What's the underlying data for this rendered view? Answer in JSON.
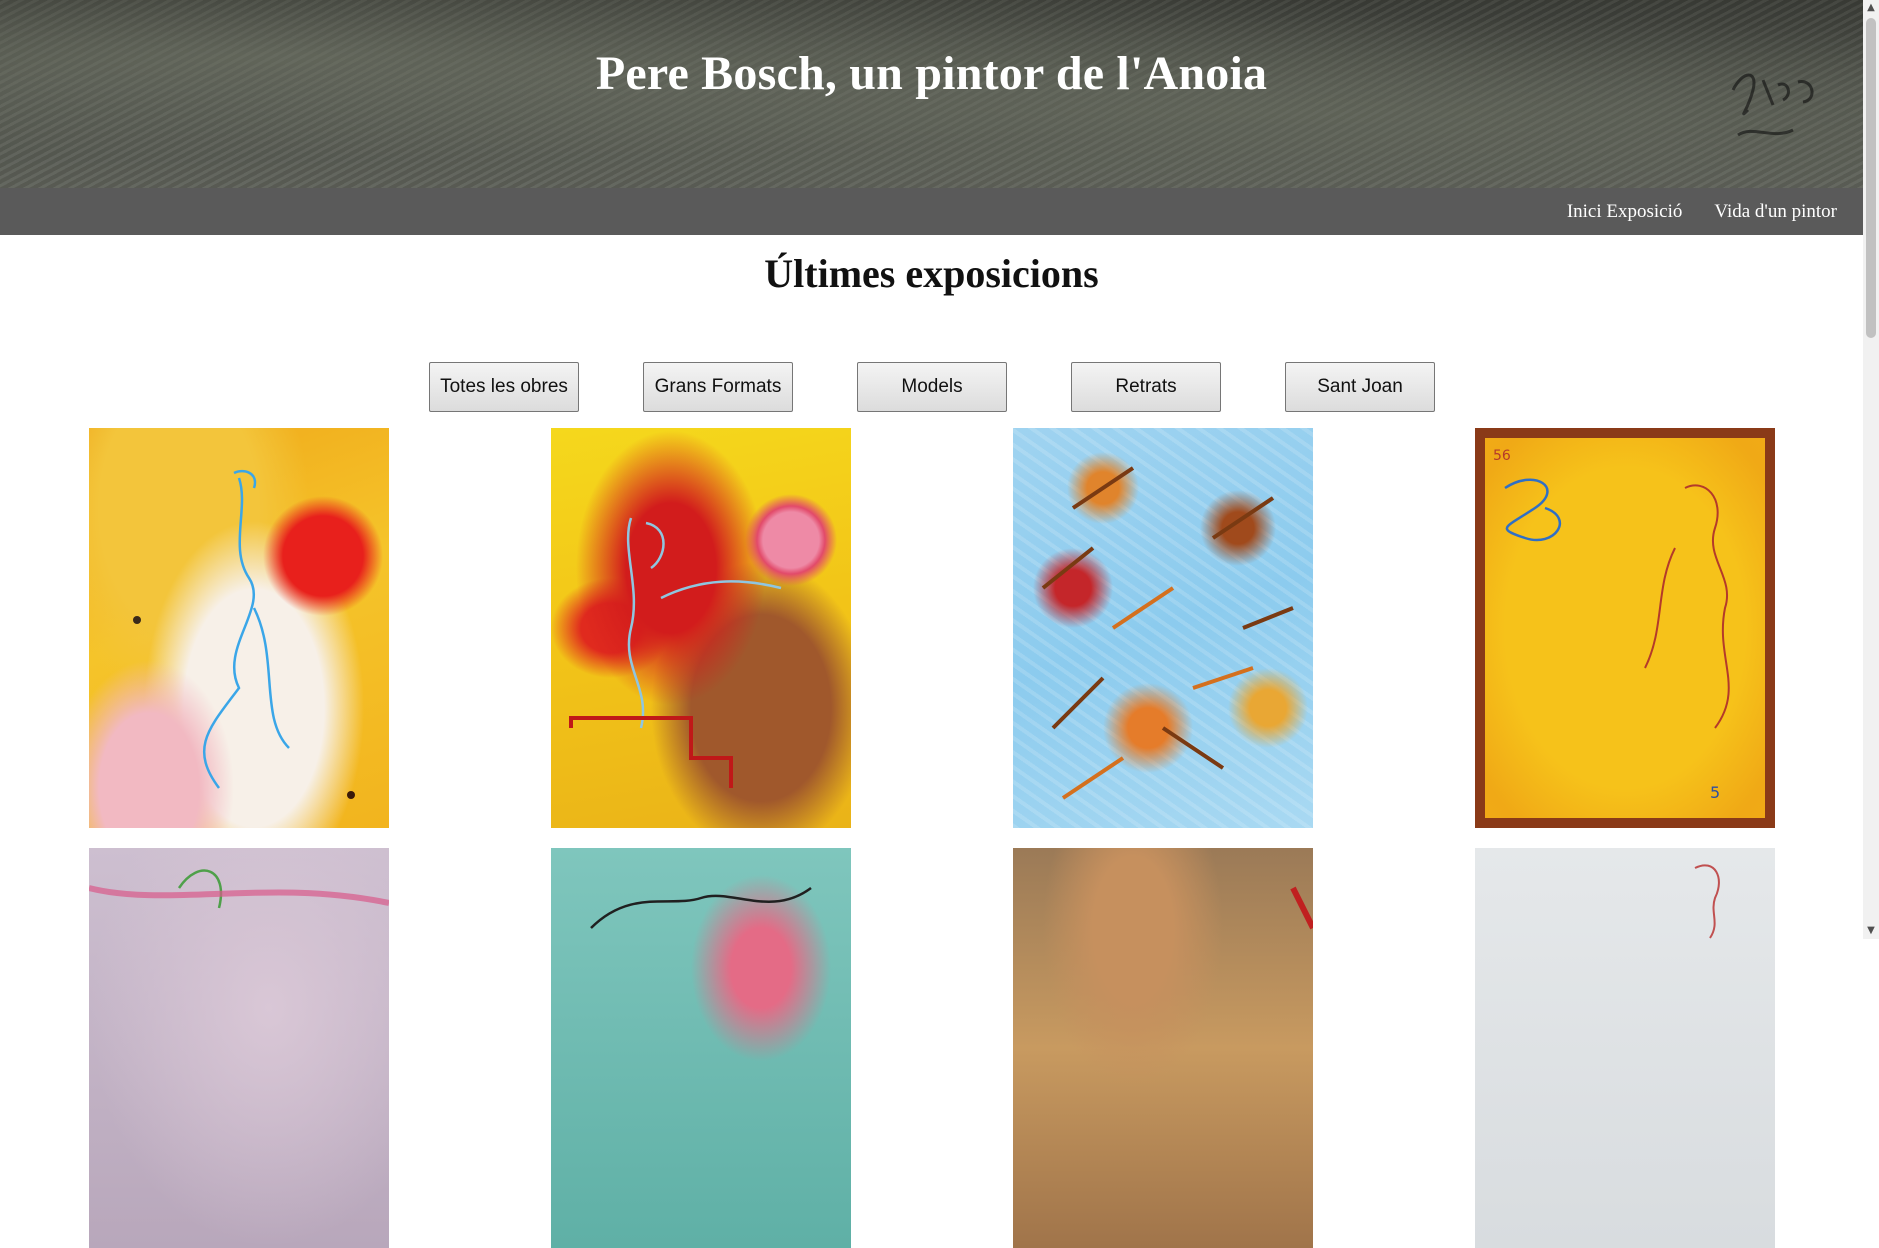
{
  "header": {
    "title": "Pere Bosch, un pintor de l'Anoia"
  },
  "nav": {
    "items": [
      {
        "label": "Inici Exposició"
      },
      {
        "label": "Vida d'un pintor"
      }
    ]
  },
  "main": {
    "section_title": "Últimes exposicions",
    "filters": [
      {
        "label": "Totes les obres"
      },
      {
        "label": "Grans Formats"
      },
      {
        "label": "Models"
      },
      {
        "label": "Retrats"
      },
      {
        "label": "Sant Joan"
      }
    ]
  },
  "gallery": {
    "artworks": [
      {
        "id": 1
      },
      {
        "id": 2
      },
      {
        "id": 3
      },
      {
        "id": 4
      },
      {
        "id": 5
      },
      {
        "id": 6
      },
      {
        "id": 7
      },
      {
        "id": 8
      }
    ]
  },
  "scrollbar": {
    "up_icon": "chevron-up-icon",
    "down_icon": "chevron-down-icon"
  },
  "colors": {
    "navbar": "#5a5a5a",
    "header_text": "#ffffff",
    "button_border": "#767676"
  }
}
